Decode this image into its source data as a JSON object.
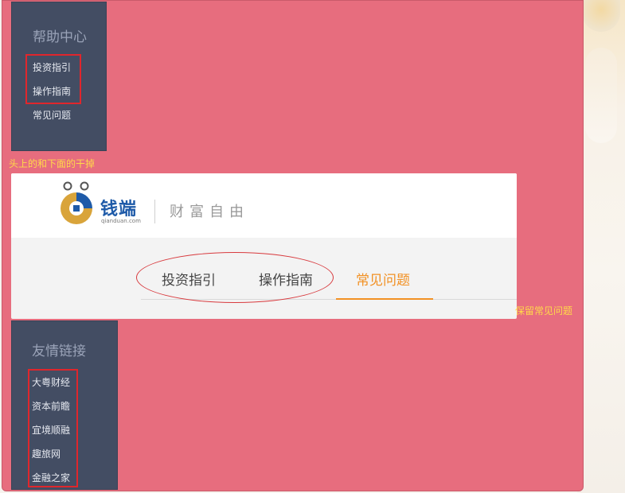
{
  "help_center": {
    "title": "帮助中心",
    "items": [
      {
        "label": "投资指引"
      },
      {
        "label": "操作指南"
      },
      {
        "label": "常见问题"
      }
    ]
  },
  "annotations": {
    "remove_note": "头上的和下面的干掉",
    "keep_note": "保留常见问题"
  },
  "card": {
    "logo_name": "钱端",
    "logo_domain": "qianduan.com",
    "slogan": "财富自由",
    "tabs": [
      {
        "label": "投资指引",
        "active": false
      },
      {
        "label": "操作指南",
        "active": false
      },
      {
        "label": "常见问题",
        "active": true
      }
    ]
  },
  "friend_links": {
    "title": "友情链接",
    "items": [
      {
        "label": "大粤财经"
      },
      {
        "label": "资本前瞻"
      },
      {
        "label": "宜境顺融"
      },
      {
        "label": "趣旅网"
      },
      {
        "label": "金融之家"
      }
    ]
  },
  "colors": {
    "panel_bg": "#e76d7e",
    "dark_box": "#434d63",
    "annotation_red": "#e0262c",
    "note_yellow": "#ffd94a",
    "active_tab": "#f29124",
    "logo_blue": "#1e5aa8",
    "logo_gold": "#d9a43a"
  }
}
